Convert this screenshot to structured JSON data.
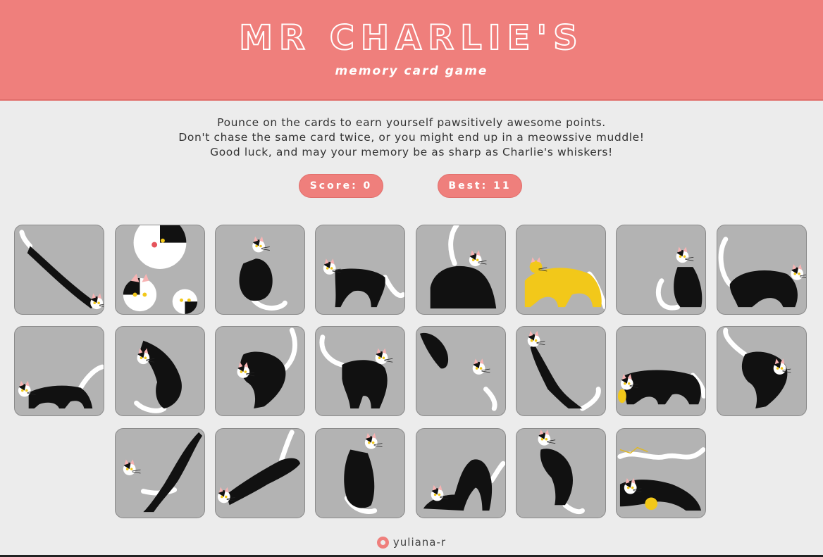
{
  "header": {
    "title": "MR CHARLIE'S",
    "subtitle": "memory card game"
  },
  "intro": {
    "line1": "Pounce on the cards to earn yourself pawsitively awesome points.",
    "line2": "Don't chase the same card twice, or you might end up in a meowssive muddle!",
    "line3": "Good luck, and may your memory be as sharp as Charlie's whiskers!"
  },
  "scoreboard": {
    "score_label": "Score: 0",
    "best_label": "Best: 11"
  },
  "cards": [
    {
      "name": "card-cat-stretching-diagonal",
      "color": "black-white"
    },
    {
      "name": "card-cat-faces-trio",
      "color": "black-white"
    },
    {
      "name": "card-cat-sitting-back",
      "color": "black-white"
    },
    {
      "name": "card-cat-walking-left",
      "color": "black-white"
    },
    {
      "name": "card-cat-loaf-tail-up",
      "color": "black-white"
    },
    {
      "name": "card-cat-yellow-walking",
      "color": "yellow"
    },
    {
      "name": "card-cat-sitting-small",
      "color": "black-white"
    },
    {
      "name": "card-cat-crouching-right",
      "color": "black-white"
    },
    {
      "name": "card-cat-walking-long",
      "color": "black-white"
    },
    {
      "name": "card-cat-rolling",
      "color": "black-white"
    },
    {
      "name": "card-cat-belly-up-bell",
      "color": "black-white"
    },
    {
      "name": "card-cat-standing-front",
      "color": "black-white"
    },
    {
      "name": "card-cat-pouncing-pair",
      "color": "black-white"
    },
    {
      "name": "card-cat-reaching-up",
      "color": "black-white"
    },
    {
      "name": "card-cat-fish-walking",
      "color": "black-white"
    },
    {
      "name": "card-cat-belly-up-bell-2",
      "color": "black-white"
    },
    {
      "name": "card-cat-jumping-pair",
      "color": "black-white"
    },
    {
      "name": "card-cat-leaping",
      "color": "black-white"
    },
    {
      "name": "card-cat-sitting-front",
      "color": "black-white"
    },
    {
      "name": "card-cat-stretching-bow",
      "color": "black-white"
    },
    {
      "name": "card-cat-standing-paws",
      "color": "black-white"
    },
    {
      "name": "card-cat-yarn-ball",
      "color": "black-white"
    }
  ],
  "colors": {
    "accent": "#ef7f7c",
    "card_bg": "#b3b3b3",
    "page_bg": "#ececec",
    "cat_yellow": "#f2c81a"
  },
  "footer": {
    "github_icon": "github-icon",
    "username": "yuliana-r"
  }
}
